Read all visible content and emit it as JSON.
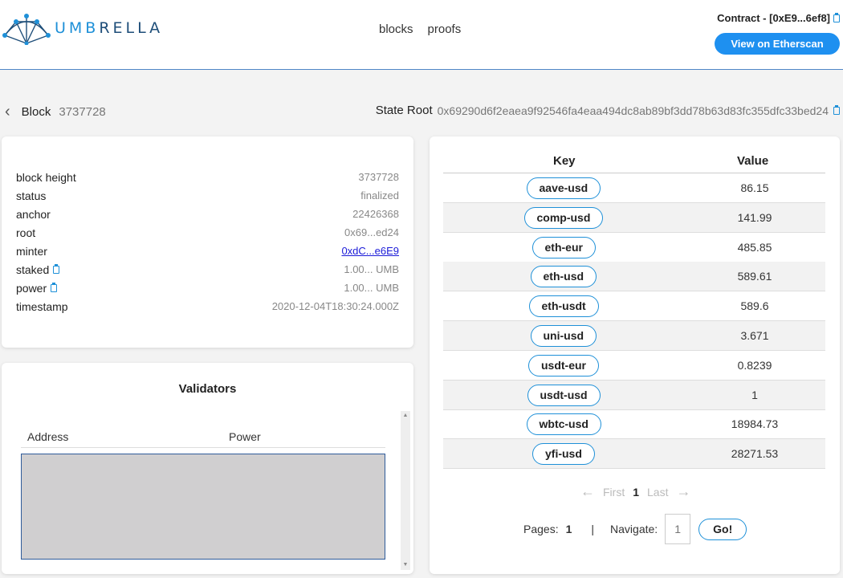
{
  "header": {
    "logo_text": "UMBRELLA",
    "nav": [
      "blocks",
      "proofs"
    ],
    "contract_label": "Contract - [0xE9...6ef8]",
    "etherscan_button": "View on Etherscan"
  },
  "breadcrumb": {
    "label": "Block",
    "number": "3737728"
  },
  "state_root": {
    "label": "State Root",
    "hash": "0x69290d6f2eaea9f92546fa4eaa494dc8ab89bf3dd78b63d83fc355dfc33bed24"
  },
  "block_info": [
    {
      "key": "block height",
      "value": "3737728"
    },
    {
      "key": "status",
      "value": "finalized"
    },
    {
      "key": "anchor",
      "value": "22426368"
    },
    {
      "key": "root",
      "value": "0x69...ed24"
    },
    {
      "key": "minter",
      "value": "0xdC...e6E9"
    },
    {
      "key": "staked",
      "value": "1.00... UMB"
    },
    {
      "key": "power",
      "value": "1.00... UMB"
    },
    {
      "key": "timestamp",
      "value": "2020-12-04T18:30:24.000Z"
    }
  ],
  "validators": {
    "title": "Validators",
    "columns": [
      "Address",
      "Power"
    ]
  },
  "kv_table": {
    "columns": [
      "Key",
      "Value"
    ],
    "rows": [
      {
        "key": "aave-usd",
        "value": "86.15"
      },
      {
        "key": "comp-usd",
        "value": "141.99"
      },
      {
        "key": "eth-eur",
        "value": "485.85"
      },
      {
        "key": "eth-usd",
        "value": "589.61"
      },
      {
        "key": "eth-usdt",
        "value": "589.6"
      },
      {
        "key": "uni-usd",
        "value": "3.671"
      },
      {
        "key": "usdt-eur",
        "value": "0.8239"
      },
      {
        "key": "usdt-usd",
        "value": "1"
      },
      {
        "key": "wbtc-usd",
        "value": "18984.73"
      },
      {
        "key": "yfi-usd",
        "value": "28271.53"
      }
    ]
  },
  "pagination": {
    "first": "First",
    "current": "1",
    "last": "Last",
    "pages_label": "Pages:",
    "pages_count": "1",
    "separator": "|",
    "navigate_label": "Navigate:",
    "navigate_placeholder": "1",
    "go_label": "Go!"
  },
  "colors": {
    "accent": "#1e90d8",
    "button": "#1e90f0",
    "header_border": "#4f86c6"
  }
}
